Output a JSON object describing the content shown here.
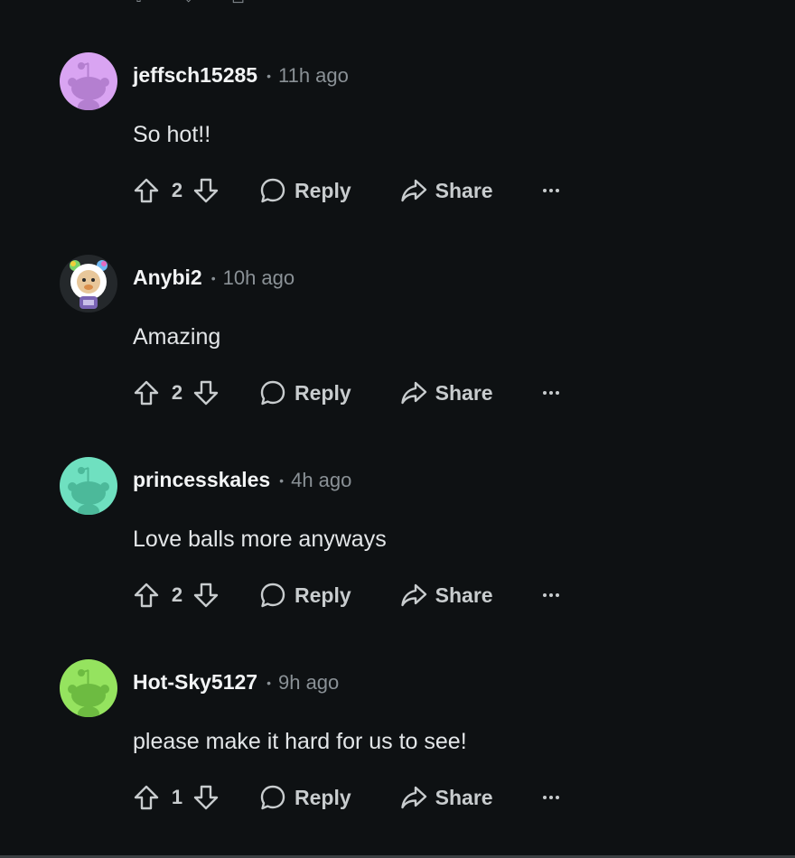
{
  "colors": {
    "background": "#0e1113",
    "username": "#f2f4f5",
    "muted": "#8a9196",
    "action": "#c8ccce"
  },
  "labels": {
    "reply": "Reply",
    "share": "Share",
    "separator": "•"
  },
  "comments": [
    {
      "username": "jeffsch15285",
      "time": "11h ago",
      "text": "So hot!!",
      "score": "2",
      "avatar_color": "#d9a4f2",
      "avatar_type": "snoo"
    },
    {
      "username": "Anybi2",
      "time": "10h ago",
      "text": "Amazing",
      "score": "2",
      "avatar_color": "#24282b",
      "avatar_type": "custom-character"
    },
    {
      "username": "princesskales",
      "time": "4h ago",
      "text": "Love balls more anyways",
      "score": "2",
      "avatar_color": "#6fe0c0",
      "avatar_type": "snoo"
    },
    {
      "username": "Hot-Sky5127",
      "time": "9h ago",
      "text": "please make it hard for us to see!",
      "score": "1",
      "avatar_color": "#95e35f",
      "avatar_type": "snoo"
    }
  ]
}
